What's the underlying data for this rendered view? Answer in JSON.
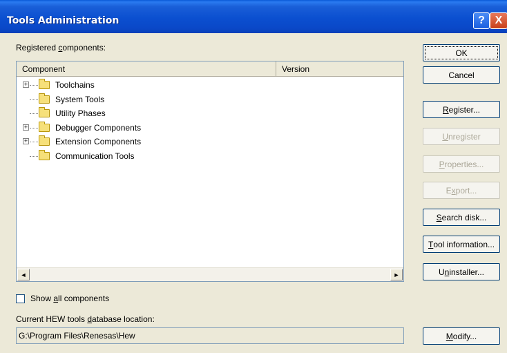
{
  "window": {
    "title": "Tools Administration",
    "help_glyph": "?",
    "close_glyph": "X"
  },
  "registered_label": {
    "pre": "Registered ",
    "accel": "c",
    "post": "omponents:"
  },
  "list": {
    "columns": [
      "Component",
      "Version"
    ],
    "items": [
      {
        "label": "Toolchains",
        "expandable": true
      },
      {
        "label": "System Tools",
        "expandable": false
      },
      {
        "label": "Utility Phases",
        "expandable": false
      },
      {
        "label": "Debugger Components",
        "expandable": true
      },
      {
        "label": "Extension Components",
        "expandable": true
      },
      {
        "label": "Communication Tools",
        "expandable": false
      }
    ],
    "scroll_left": "◄",
    "scroll_right": "►"
  },
  "buttons": {
    "ok": {
      "pre": "",
      "accel": "",
      "post": "OK"
    },
    "cancel": {
      "pre": "",
      "accel": "",
      "post": "Cancel"
    },
    "register": {
      "pre": "",
      "accel": "R",
      "post": "egister..."
    },
    "unregister": {
      "pre": "",
      "accel": "U",
      "post": "nregister"
    },
    "properties": {
      "pre": "",
      "accel": "P",
      "post": "roperties..."
    },
    "export": {
      "pre": "E",
      "accel": "x",
      "post": "port..."
    },
    "search_disk": {
      "pre": "",
      "accel": "S",
      "post": "earch disk..."
    },
    "tool_information": {
      "pre": "",
      "accel": "T",
      "post": "ool information..."
    },
    "uninstaller": {
      "pre": "U",
      "accel": "n",
      "post": "installer..."
    },
    "modify": {
      "pre": "",
      "accel": "M",
      "post": "odify..."
    }
  },
  "show_all": {
    "pre": "Show ",
    "accel": "a",
    "post": "ll components"
  },
  "db_location_label": {
    "pre": "Current HEW tools ",
    "accel": "d",
    "post": "atabase location:"
  },
  "db_location_value": "G:\\Program Files\\Renesas\\Hew",
  "colors": {
    "titlebar": "#0a4fd0",
    "dialog_bg": "#ece9d8",
    "disabled_text": "#aca899"
  }
}
